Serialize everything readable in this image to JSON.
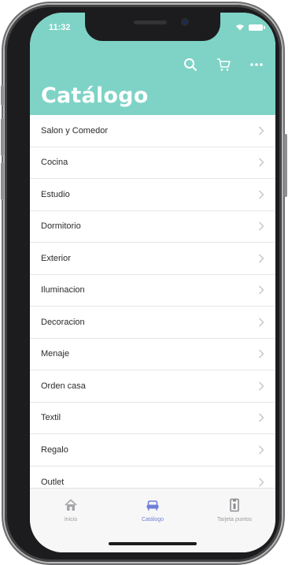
{
  "status_bar": {
    "time": "11:32"
  },
  "header": {
    "title": "Catálogo",
    "actions": [
      {
        "icon": "search-icon"
      },
      {
        "icon": "cart-icon"
      },
      {
        "icon": "more-icon"
      }
    ],
    "color": "#7ed3c6"
  },
  "catalog": {
    "items": [
      {
        "label": "Salon y Comedor"
      },
      {
        "label": "Cocina"
      },
      {
        "label": "Estudio"
      },
      {
        "label": "Dormitorio"
      },
      {
        "label": "Exterior"
      },
      {
        "label": "Iluminacion"
      },
      {
        "label": "Decoracion"
      },
      {
        "label": "Menaje"
      },
      {
        "label": "Orden casa"
      },
      {
        "label": "Textil"
      },
      {
        "label": "Regalo"
      },
      {
        "label": "Outlet"
      }
    ]
  },
  "tabbar": {
    "active_color": "#6f7fd8",
    "tabs": [
      {
        "label": "Inicio",
        "icon": "home-icon",
        "active": false
      },
      {
        "label": "Catálogo",
        "icon": "sofa-icon",
        "active": true
      },
      {
        "label": "Tarjeta puntos",
        "icon": "card-icon",
        "active": false
      }
    ]
  }
}
